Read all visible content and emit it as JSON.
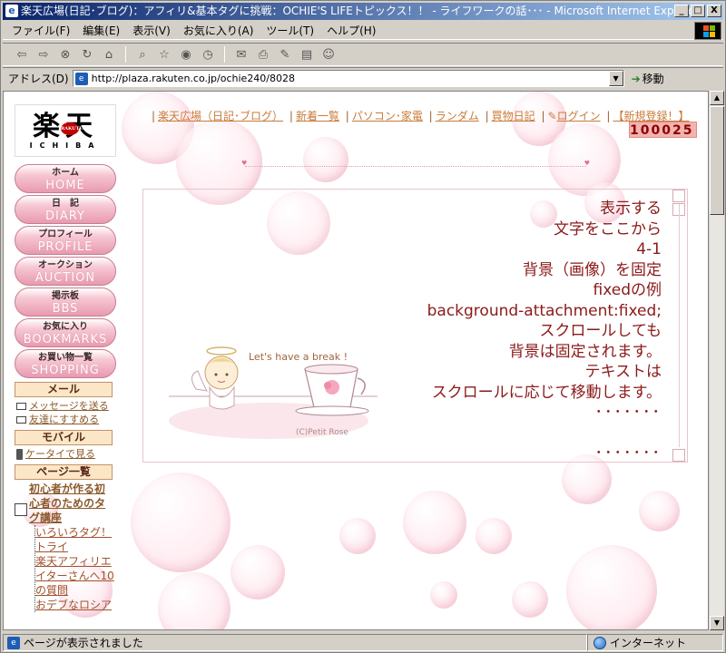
{
  "window": {
    "title": "楽天広場(日記･ブログ)：アフィリ&基本タグに挑戦：OCHIE'S LIFEトピックス！！ - ライフワークの話･･･ - Microsoft Internet Explorer",
    "min": "_",
    "max": "□",
    "close": "X"
  },
  "menu": [
    "ファイル(F)",
    "編集(E)",
    "表示(V)",
    "お気に入り(A)",
    "ツール(T)",
    "ヘルプ(H)"
  ],
  "address": {
    "label": "アドレス(D)",
    "url": "http://plaza.rakuten.co.jp/ochie240/8028",
    "go_label": "移動"
  },
  "status": {
    "text": "ページが表示されました",
    "zone": "インターネット"
  },
  "logo": {
    "kanji": "楽天",
    "badge": "RAKUTEN",
    "sub": "ICHIBA"
  },
  "nav_buttons": [
    {
      "jp": "ホーム",
      "en": "HOME"
    },
    {
      "jp": "日　記",
      "en": "DIARY"
    },
    {
      "jp": "プロフィール",
      "en": "PROFILE"
    },
    {
      "jp": "オークション",
      "en": "AUCTION"
    },
    {
      "jp": "掲示板",
      "en": "BBS"
    },
    {
      "jp": "お気に入り",
      "en": "BOOKMARKS"
    },
    {
      "jp": "お買い物一覧",
      "en": "SHOPPING LIST"
    }
  ],
  "mail": {
    "title": "メール",
    "links": [
      "メッセージを送る",
      "友達にすすめる"
    ]
  },
  "mobile": {
    "title": "モバイル",
    "link": "ケータイで見る"
  },
  "pages": {
    "title": "ページ一覧",
    "main": "初心者が作る初心者のためのタグ講座",
    "subs": [
      "いろいろタグ！トライ",
      "楽天アフィリエイターさんへ10の質問",
      "おデブなロシア"
    ]
  },
  "topnav": {
    "links": [
      "楽天広場（日記･ブログ）",
      "新着一覧",
      "パソコン･家電",
      "ランダム",
      "買物日記",
      "ログイン",
      "【新規登録！】"
    ],
    "counter": "100025"
  },
  "panel": {
    "lines": [
      "表示する",
      "文字をここから",
      "4-1",
      "背景（画像）を固定",
      "fixedの例",
      "background-attachment:fixed;",
      "スクロールしても",
      "背景は固定されます。",
      "テキストは",
      "スクロールに応じて移動します。"
    ],
    "dots": "･･･････",
    "image_caption": "Let's have a break !",
    "credit": "(C)Petit Rose"
  }
}
